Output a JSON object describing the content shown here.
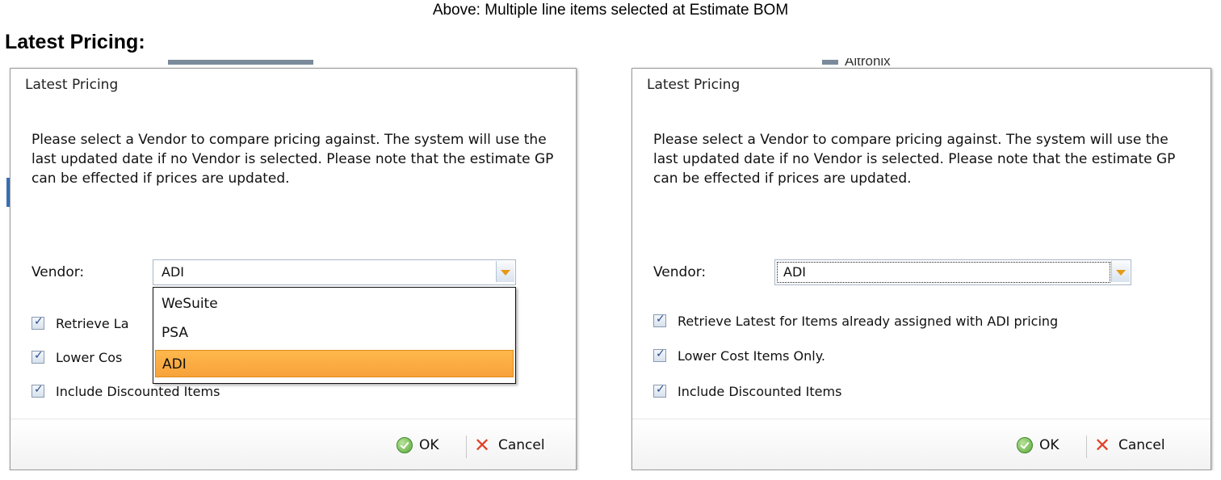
{
  "caption": "Above: Multiple line items selected at Estimate BOM",
  "heading": "Latest Pricing:",
  "left_dialog": {
    "title": "Latest Pricing",
    "message": "Please select a Vendor to compare pricing against. The system will use the last updated date if no Vendor is selected.  Please note that the estimate GP can be effected if prices are updated.",
    "vendor_label": "Vendor:",
    "vendor_value": "ADI",
    "dropdown_options": [
      "WeSuite",
      "PSA",
      "ADI"
    ],
    "selected_option": "ADI",
    "checkboxes": [
      {
        "label": "Retrieve La",
        "checked": true
      },
      {
        "label": "Lower Cos",
        "checked": true
      },
      {
        "label": "Include Discounted Items",
        "checked": true
      }
    ],
    "ok_label": "OK",
    "cancel_label": "Cancel"
  },
  "right_dialog": {
    "title": "Latest Pricing",
    "message": "Please select a Vendor to compare pricing against. The system will use the last updated date if no Vendor is selected.  Please note that the estimate GP can be effected if prices are updated.",
    "vendor_label": "Vendor:",
    "vendor_value": "ADI",
    "checkboxes": [
      {
        "label": "Retrieve Latest for Items already assigned with ADI pricing",
        "checked": true
      },
      {
        "label": "Lower Cost Items Only.",
        "checked": true
      },
      {
        "label": "Include Discounted Items",
        "checked": true
      }
    ],
    "ok_label": "OK",
    "cancel_label": "Cancel"
  },
  "background": {
    "right_top_text": "Altronix"
  },
  "colors": {
    "selected_item": "#f7a23a",
    "combo_arrow": "#e59a17",
    "cancel_icon": "#e0432a",
    "ok_icon": "#5aa83a"
  }
}
